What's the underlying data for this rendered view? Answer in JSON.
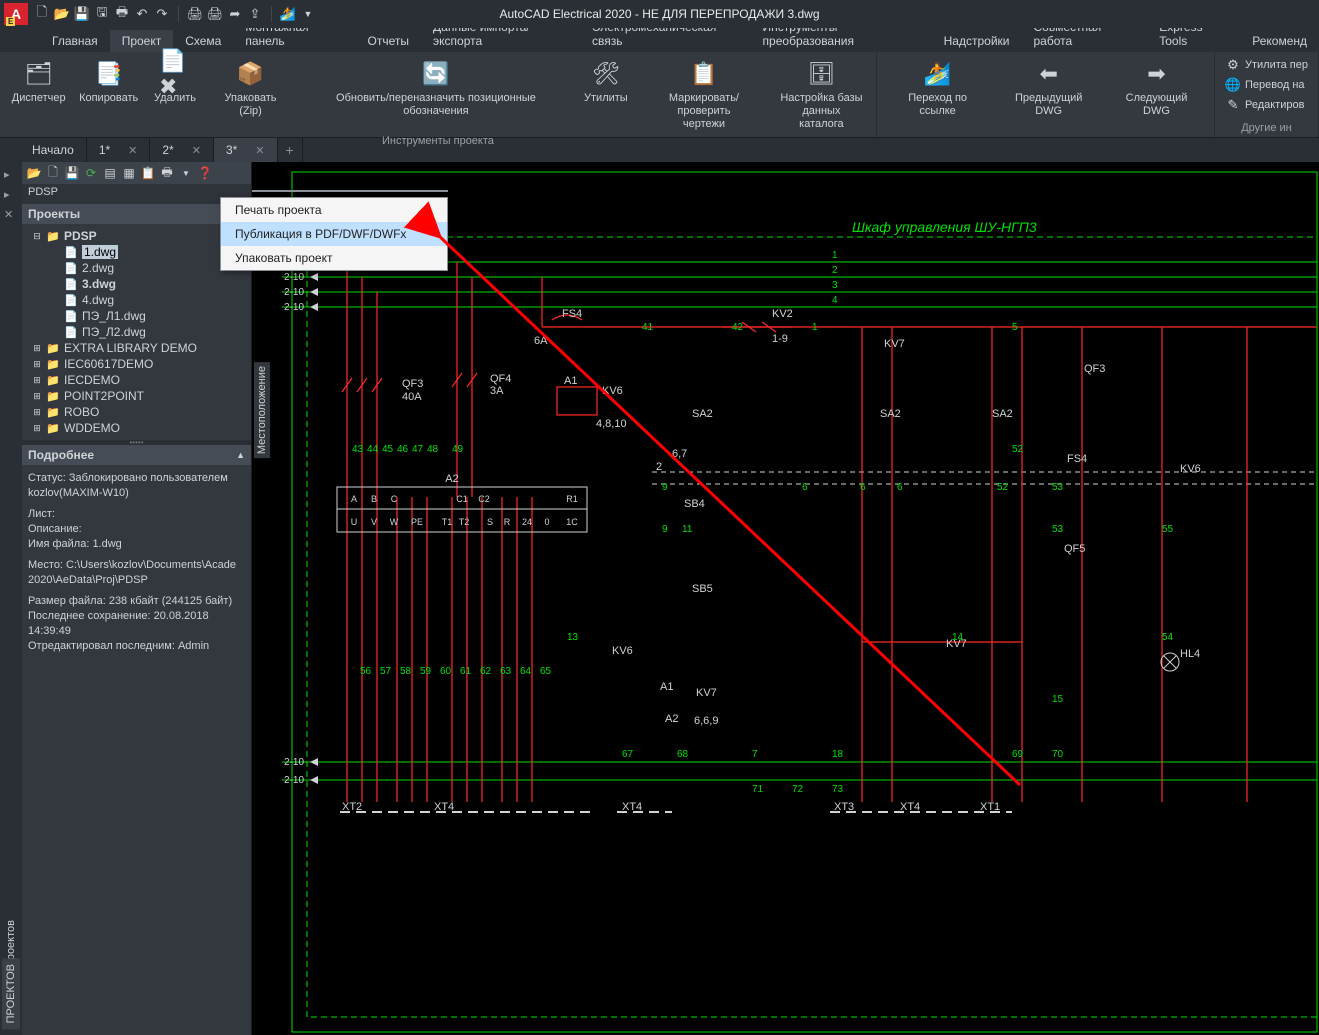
{
  "title": "AutoCAD Electrical 2020 - НЕ ДЛЯ ПЕРЕПРОДАЖИ   3.dwg",
  "app_logo": "A",
  "qat_icons": [
    "new",
    "open",
    "save",
    "saveas",
    "print",
    "undo",
    "redo",
    "sep",
    "plot",
    "batch",
    "share",
    "export",
    "sep2",
    "cloud"
  ],
  "ribbon": {
    "tabs": [
      "Главная",
      "Проект",
      "Схема",
      "Монтажная панель",
      "Отчеты",
      "Данные импорта/экспорта",
      "Электромеханическая связь",
      "Инструменты преобразования",
      "Надстройки",
      "Совместная работа",
      "Express Tools",
      "Рекоменд"
    ],
    "active_tab": 1,
    "groups": [
      {
        "label": "Инструменты проекта",
        "buttons": [
          {
            "name": "dispatcher",
            "icon": "🗂",
            "label": "Диспетчер"
          },
          {
            "name": "copy",
            "icon": "📑",
            "label": "Копировать"
          },
          {
            "name": "delete",
            "icon": "📄✖",
            "label": "Удалить"
          },
          {
            "name": "zip",
            "icon": "📦",
            "label": "Упаковать (Zip)"
          },
          {
            "name": "refresh",
            "icon": "🔄",
            "label": "Обновить/переназначить позиционные обозначения"
          },
          {
            "name": "utils",
            "icon": "🛠",
            "label": "Утилиты"
          },
          {
            "name": "mark",
            "icon": "📋",
            "label": "Маркировать/проверить\nчертежи"
          },
          {
            "name": "catalog",
            "icon": "🗄",
            "label": "Настройка базы\nданных каталога"
          }
        ]
      },
      {
        "label": "",
        "buttons": [
          {
            "name": "link",
            "icon": "🏄",
            "label": "Переход по ссылке"
          },
          {
            "name": "prev",
            "icon": "⬅",
            "label": "Предыдущий DWG"
          },
          {
            "name": "next",
            "icon": "➡",
            "label": "Следующий DWG"
          }
        ]
      },
      {
        "label": "Другие ин",
        "small": true,
        "buttons": [
          {
            "name": "migrate",
            "icon": "⚙",
            "label": "Утилита пер"
          },
          {
            "name": "translate",
            "icon": "🌐",
            "label": "Перевод на"
          },
          {
            "name": "edit",
            "icon": "✎",
            "label": "Редактиров"
          }
        ]
      }
    ]
  },
  "doctabs": [
    {
      "label": "Начало",
      "closable": false
    },
    {
      "label": "1*",
      "closable": true
    },
    {
      "label": "2*",
      "closable": true
    },
    {
      "label": "3*",
      "closable": true,
      "active": true
    }
  ],
  "sidestrip_label": "Диспетчер проектов",
  "project": {
    "path": "PDSP",
    "header": "Проекты",
    "tree": [
      {
        "type": "folder",
        "label": "PDSP",
        "expanded": true,
        "bold": true,
        "lvl": 1,
        "children": [
          {
            "type": "file",
            "label": "1.dwg",
            "sel": true
          },
          {
            "type": "file",
            "label": "2.dwg"
          },
          {
            "type": "file",
            "label": "3.dwg",
            "bold": true
          },
          {
            "type": "file",
            "label": "4.dwg"
          },
          {
            "type": "file",
            "label": "ПЭ_Л1.dwg"
          },
          {
            "type": "file",
            "label": "ПЭ_Л2.dwg"
          }
        ]
      },
      {
        "type": "folder",
        "label": "EXTRA LIBRARY DEMO",
        "lvl": 1
      },
      {
        "type": "folder",
        "label": "IEC60617DEMO",
        "lvl": 1
      },
      {
        "type": "folder",
        "label": "IECDEMO",
        "lvl": 1
      },
      {
        "type": "folder",
        "label": "POINT2POINT",
        "lvl": 1
      },
      {
        "type": "folder",
        "label": "ROBO",
        "lvl": 1
      },
      {
        "type": "folder",
        "label": "WDDEMO",
        "lvl": 1
      }
    ],
    "details_header": "Подробнее",
    "details": {
      "status": "Статус: Заблокировано пользователем kozlov(MAXIM-W10)",
      "sheet": "Лист:",
      "desc": "Описание:",
      "filename": "Имя файла: 1.dwg",
      "location": "Место: C:\\Users\\kozlov\\Documents\\Acade 2020\\AeData\\Proj\\PDSP",
      "size": "Размер файла: 238 кбайт (244125 байт)",
      "saved": "Последнее сохранение: 20.08.2018 14:39:49",
      "editor": "Отредактировал последним: Admin"
    }
  },
  "context_menu": {
    "items": [
      {
        "label": "Печать проекта"
      },
      {
        "label": "Публикация в PDF/DWF/DWFx",
        "highlight": true
      },
      {
        "label": "Упаковать проект"
      }
    ]
  },
  "drawing": {
    "title": "Шкаф управления ШУ-НГП3",
    "loc_label": "Местоположение",
    "refs": {
      "QF3": "QF3",
      "QF3a": "40A",
      "QF4": "QF4",
      "QF4a": "3A",
      "QF5": "QF5",
      "FS4": "FS4",
      "FS4b": "FS4",
      "KV2": "KV2",
      "KV2r": "1-9",
      "KV6": "KV6",
      "KV6b": "KV6",
      "KV7": "KV7",
      "KV7b": "KV7",
      "A1": "A1",
      "A1b": "A1",
      "A2": "A2",
      "A2b": "A2",
      "A2r": "4,8,10",
      "A2r2": "6,6,9",
      "SA2": "SA2",
      "SB4": "SB4",
      "SB5": "SB5",
      "HL4": "HL4",
      "XT1": "XT1",
      "XT2": "XT2",
      "XT3": "XT3",
      "XT4": "XT4",
      "XT4b": "XT4",
      "XT4c": "XT4",
      "c6A": "6A",
      "c67": "6,7",
      "c2": "2"
    },
    "block": {
      "A": "A",
      "B": "B",
      "C": "C",
      "C1": "C1",
      "C2": "C2",
      "R1": "R1",
      "U": "U",
      "V": "V",
      "W": "W",
      "PE": "PE",
      "T1": "T1",
      "T2": "T2",
      "S": "S",
      "R": "R",
      "D24": "24",
      "D0": "0",
      "D1C": "1C"
    },
    "wires_top": [
      "1",
      "2",
      "3",
      "4"
    ],
    "wires_left": [
      "2-10",
      "2-10",
      "2-10",
      "2-10",
      "2-10",
      "2-10"
    ],
    "nums": {
      "row1": [
        "41",
        "42",
        "1",
        "5"
      ],
      "row2": [
        "41",
        "42",
        "1",
        "5"
      ],
      "row3": [
        "43",
        "44",
        "45",
        "46",
        "47",
        "48",
        "49",
        "52"
      ],
      "row4": [
        "9",
        "6",
        "6",
        "6",
        "52",
        "53"
      ],
      "row5": [
        "9",
        "11",
        "53",
        "55"
      ],
      "row6": [
        "56",
        "57",
        "58",
        "59",
        "60",
        "61",
        "62",
        "63",
        "64",
        "65"
      ],
      "row7": [
        "13",
        "14",
        "54"
      ],
      "row8": [
        "15"
      ],
      "row9": [
        "67",
        "68",
        "7",
        "18",
        "69",
        "70"
      ],
      "row10": [
        "71",
        "72",
        "73"
      ]
    }
  },
  "bottom_tab": "ПРОЕКТОВ"
}
